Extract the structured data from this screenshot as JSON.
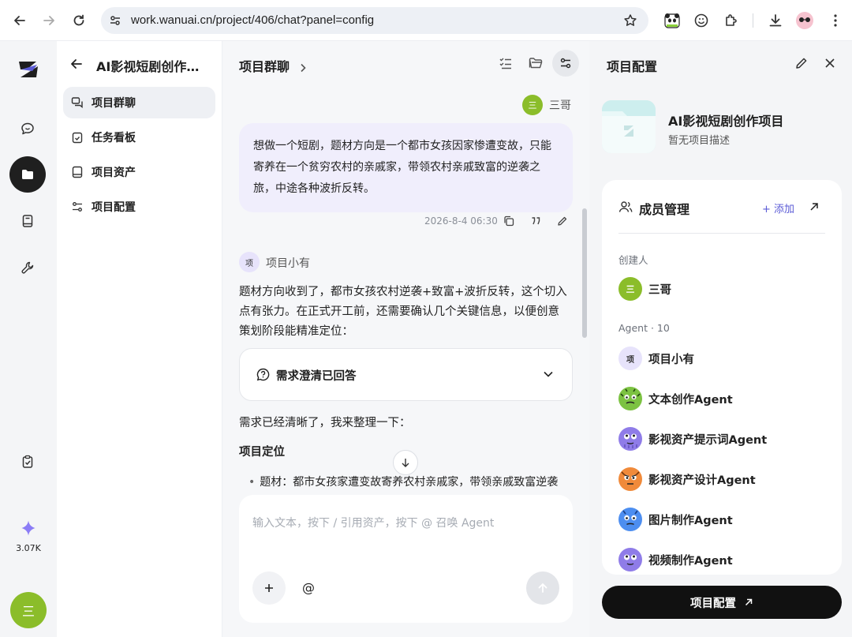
{
  "browser": {
    "url": "work.wanuai.cn/project/406/chat?panel=config"
  },
  "rail": {
    "credits": "3.07K",
    "user_initial": "三"
  },
  "sidebar": {
    "project_title": "AI影视短剧创作…",
    "items": [
      {
        "label": "项目群聊",
        "icon": "chat-bubbles-icon",
        "active": true
      },
      {
        "label": "任务看板",
        "icon": "clipboard-check-icon",
        "active": false
      },
      {
        "label": "项目资产",
        "icon": "book-icon",
        "active": false
      },
      {
        "label": "项目配置",
        "icon": "sliders-icon",
        "active": false
      }
    ]
  },
  "chat": {
    "title": "项目群聊",
    "user_name": "三哥",
    "user_initial": "三",
    "user_message": "想做一个短剧，题材方向是一个都市女孩因家惨遭变故，只能寄养在一个贫穷农村的亲戚家，带领农村亲戚致富的逆袭之旅，中途各种波折反转。",
    "timestamp": "2026-8-4 06:30",
    "agent_name": "项目小有",
    "agent_initial": "项",
    "agent_reply": "题材方向收到了，都市女孩农村逆袭+致富+波折反转，这个切入点有张力。在正式开工前，还需要确认几个关键信息，以便创意策划阶段能精准定位：",
    "collapse_label": "需求澄清已回答",
    "followup": "需求已经清晰了，我来整理一下：",
    "section_title": "项目定位",
    "bullet": "题材：都市女孩家遭变故寄养农村亲戚家，带领亲戚致富逆袭",
    "input_placeholder": "输入文本，按下 / 引用资产，按下 @ 召唤 Agent",
    "at_label": "@"
  },
  "panel": {
    "title": "项目配置",
    "project_name": "AI影视短剧创作项目",
    "project_desc": "暂无项目描述",
    "members_title": "成员管理",
    "add_label": "+ 添加",
    "creator_label": "创建人",
    "creator_name": "三哥",
    "creator_initial": "三",
    "agent_label": "Agent · 10",
    "agents": [
      {
        "name": "项目小有",
        "initial": "项"
      },
      {
        "name": "文本创作Agent"
      },
      {
        "name": "影视资产提示词Agent"
      },
      {
        "name": "影视资产设计Agent"
      },
      {
        "name": "图片制作Agent"
      },
      {
        "name": "视频制作Agent"
      }
    ],
    "config_button": "项目配置"
  },
  "colors": {
    "accent_purple": "#5b5bd6",
    "user_green": "#8bbd2a",
    "bubble": "#f0eefc"
  }
}
